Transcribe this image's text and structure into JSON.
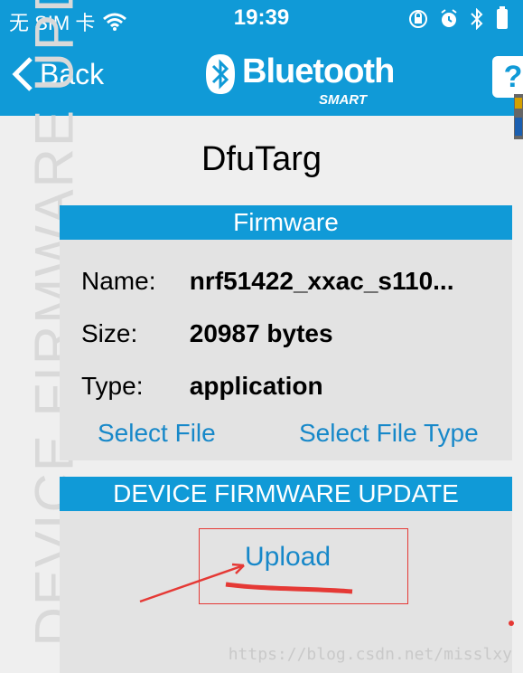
{
  "status_bar": {
    "carrier": "无 SIM 卡",
    "time": "19:39"
  },
  "nav": {
    "back_label": "Back",
    "logo_text": "Bluetooth",
    "logo_subtext": "SMART",
    "help_label": "?"
  },
  "page_title": "DfuTarg",
  "side_label": "DEVICE FIRMWARE UPDATE",
  "firmware": {
    "header": "Firmware",
    "name_label": "Name:",
    "name_value": "nrf51422_xxac_s110...",
    "size_label": "Size:",
    "size_value": "20987 bytes",
    "type_label": "Type:",
    "type_value": "application",
    "select_file": "Select File",
    "select_file_type": "Select File Type"
  },
  "update": {
    "header": "DEVICE FIRMWARE UPDATE",
    "upload": "Upload"
  },
  "watermark": "https://blog.csdn.net/misslxy",
  "colors": {
    "primary": "#109ad7",
    "link": "#1788c9",
    "annotation": "#e53935"
  }
}
